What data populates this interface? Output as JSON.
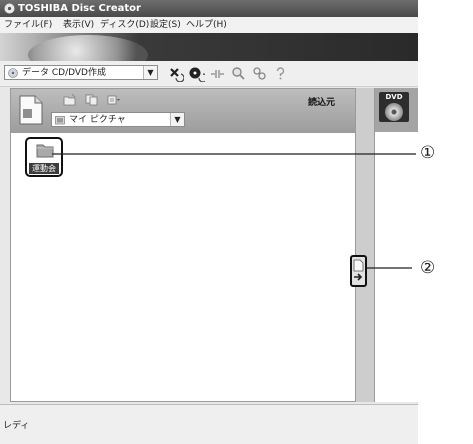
{
  "window": {
    "title": "TOSHIBA Disc Creator"
  },
  "menu": [
    "ファイル(F)",
    "表示(V)",
    "ディスク(D)",
    "設定(S)",
    "ヘルプ(H)"
  ],
  "toolbar": {
    "mode_select": "データ CD/DVD作成",
    "buttons": [
      {
        "name": "delete-icon"
      },
      {
        "name": "disc-info-icon"
      },
      {
        "name": "burn-icon"
      },
      {
        "name": "search-icon"
      },
      {
        "name": "tools-icon"
      },
      {
        "name": "help-icon"
      }
    ]
  },
  "left_pane": {
    "header_label": "読込元",
    "location_select": "マイ ピクチャ",
    "items": [
      {
        "label": "運動会",
        "icon": "folder-icon"
      }
    ]
  },
  "right_pane": {
    "disc_label": "DVD"
  },
  "status": {
    "text": "レディ"
  },
  "callouts": [
    {
      "label": "①"
    },
    {
      "label": "②"
    }
  ]
}
